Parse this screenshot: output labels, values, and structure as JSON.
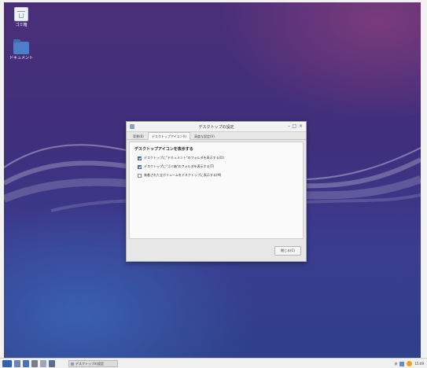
{
  "desktop": {
    "icons": [
      {
        "label": "ゴミ箱",
        "icon": "trash-icon"
      },
      {
        "label": "ドキュメント",
        "icon": "folder-icon"
      }
    ]
  },
  "dialog": {
    "title": "デスクトップの設定",
    "controls": {
      "minimize": "–",
      "maximize": "□",
      "close": "×"
    },
    "tabs": [
      "背景(B)",
      "デスクトップアイコン(I)",
      "高度な設定(V)"
    ],
    "active_tab_index": 1,
    "section_title": "デスクトップアイコンを表示する",
    "options": [
      {
        "label": "デスクトップに\"ドキュメント\"のフォルダを表示する(D)",
        "checked": true
      },
      {
        "label": "デスクトップに\"ゴミ箱\"のフォルダを表示する(T)",
        "checked": true
      },
      {
        "label": "装着された全ボリュームをデスクトップに表示する(M)",
        "checked": false
      }
    ],
    "close_button": "閉じる(C)"
  },
  "taskbar": {
    "active_task": "デスクトップの設定",
    "tray": {
      "ime": "あ",
      "clock": "15:09"
    }
  },
  "colors": {
    "accent": "#4a79c6",
    "desktop_top": "#4a2f78",
    "desktop_bottom": "#2f3f88"
  }
}
